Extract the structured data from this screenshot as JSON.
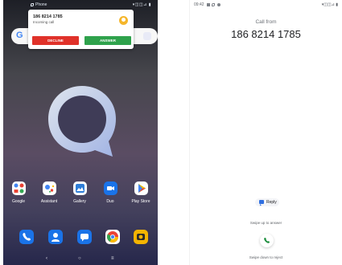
{
  "left_phone": {
    "status_bar": {
      "app": "Phone",
      "right_icons": "▾◫◫⊿ ▮"
    },
    "search_bar": {
      "logo": "G"
    },
    "notification": {
      "caller_number": "186 8214 1785",
      "subtitle": "Incoming call",
      "decline_label": "DECLINE",
      "answer_label": "ANSWER",
      "decline_color": "#e0322a",
      "answer_color": "#2fa24c"
    },
    "home_apps": [
      {
        "label": "Google",
        "icon": "google-folder-icon",
        "color": "#ffffff"
      },
      {
        "label": "Assistant",
        "icon": "assistant-icon",
        "color": "#ffffff"
      },
      {
        "label": "Gallery",
        "icon": "gallery-icon",
        "color": "#ffffff"
      },
      {
        "label": "Duo",
        "icon": "duo-icon",
        "color": "#1a73e8"
      },
      {
        "label": "Play Store",
        "icon": "play-store-icon",
        "color": "#ffffff"
      }
    ],
    "dock": [
      {
        "icon": "phone-icon",
        "color": "#1a73e8"
      },
      {
        "icon": "contacts-icon",
        "color": "#1a73e8"
      },
      {
        "icon": "messages-icon",
        "color": "#1a73e8"
      },
      {
        "icon": "chrome-icon",
        "color": "#ffffff"
      },
      {
        "icon": "camera-icon",
        "color": "#f4b400"
      }
    ],
    "navbar": {
      "back": "‹",
      "home": "○",
      "recents": "≡"
    }
  },
  "right_phone": {
    "status_bar": {
      "time": "09:42",
      "right_icons": "▾◫◫⊿ ▮"
    },
    "call_from": "Call from",
    "caller_number": "186 8214 1785",
    "reply_label": "Reply",
    "swipe_up_hint": "Swipe up to answer",
    "swipe_down_hint": "Swipe down to reject",
    "answer_color": "#1e8e3e"
  }
}
